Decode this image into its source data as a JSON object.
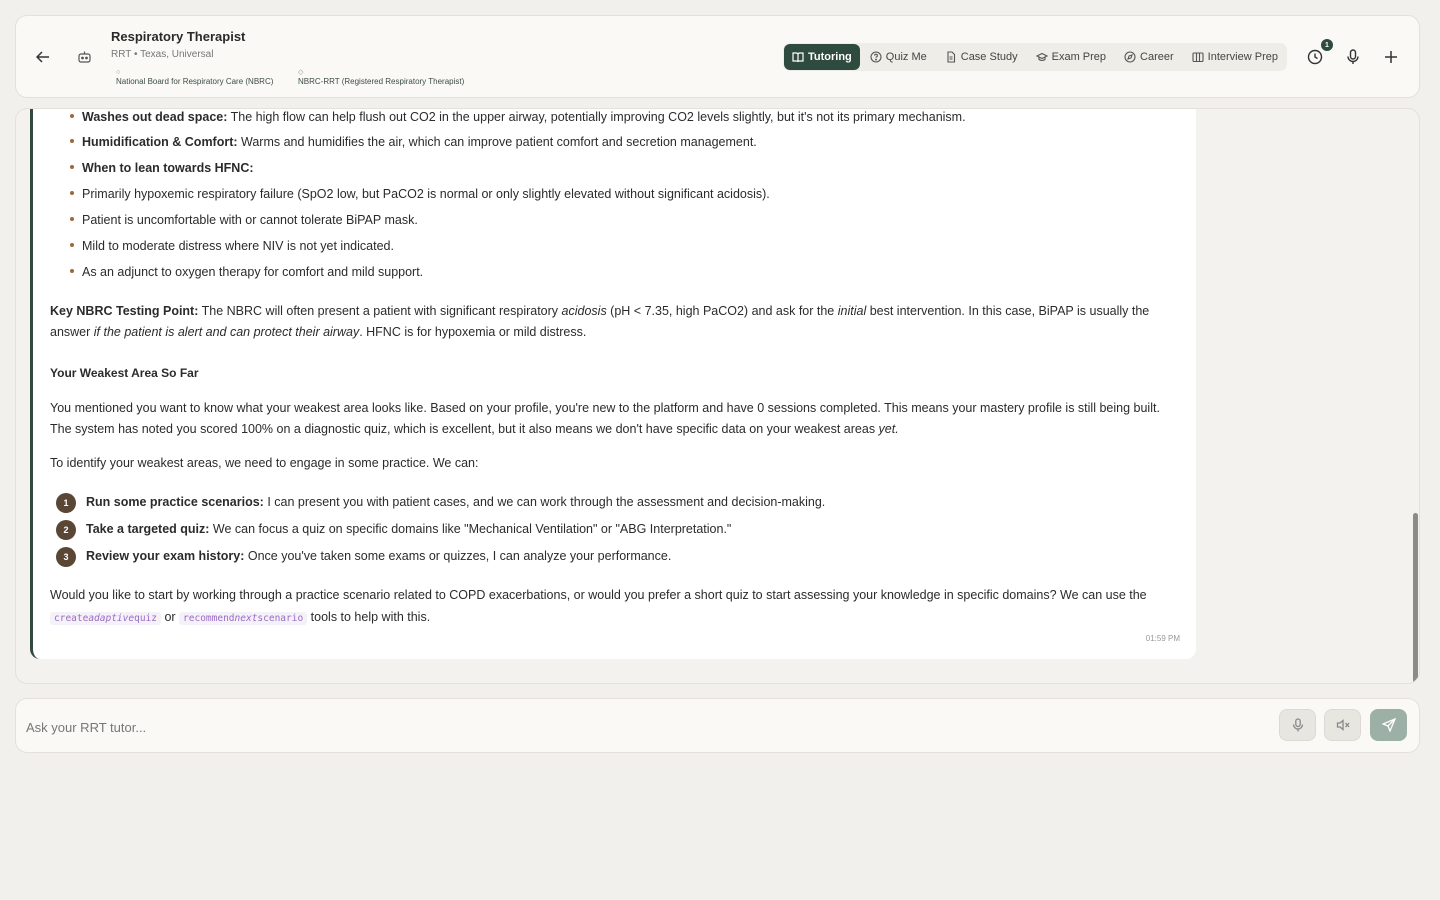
{
  "header": {
    "title": "Respiratory Therapist",
    "subtitle": "RRT • Texas, Universal",
    "badges": [
      {
        "mark": "○",
        "label": "National Board for Respiratory Care (NBRC)"
      },
      {
        "mark": "◇",
        "label": "NBRC-RRT (Registered Respiratory Therapist)"
      }
    ],
    "tabs": [
      "Tutoring",
      "Quiz Me",
      "Case Study",
      "Exam Prep",
      "Career",
      "Interview Prep"
    ],
    "active_tab": "Tutoring",
    "history_count": "1"
  },
  "message": {
    "bullets": [
      {
        "bold": "Washes out dead space:",
        "text": " The high flow can help flush out CO2 in the upper airway, potentially improving CO2 levels slightly, but it's not its primary mechanism."
      },
      {
        "bold": "Humidification & Comfort:",
        "text": " Warms and humidifies the air, which can improve patient comfort and secretion management."
      },
      {
        "bold": "When to lean towards HFNC:",
        "text": ""
      },
      {
        "bold": "",
        "text": "Primarily hypoxemic respiratory failure (SpO2 low, but PaCO2 is normal or only slightly elevated without significant acidosis)."
      },
      {
        "bold": "",
        "text": "Patient is uncomfortable with or cannot tolerate BiPAP mask."
      },
      {
        "bold": "",
        "text": "Mild to moderate distress where NIV is not yet indicated."
      },
      {
        "bold": "",
        "text": "As an adjunct to oxygen therapy for comfort and mild support."
      }
    ],
    "key_point": {
      "bold": "Key NBRC Testing Point:",
      "t1": " The NBRC will often present a patient with significant respiratory ",
      "i1": "acidosis",
      "t2": " (pH < 7.35, high PaCO2) and ask for the ",
      "i2": "initial",
      "t3": " best intervention. In this case, BiPAP is usually the answer ",
      "i3": "if the patient is alert and can protect their airway",
      "t4": ". HFNC is for hypoxemia or mild distress."
    },
    "heading": "Your Weakest Area So Far",
    "weak_para": {
      "text": "You mentioned you want to know what your weakest area looks like. Based on your profile, you're new to the platform and have 0 sessions completed. This means your mastery profile is still being built. The system has noted you scored 100% on a diagnostic quiz, which is excellent, but it also means we don't have specific data on your weakest areas ",
      "italic": "yet."
    },
    "identify": "To identify your weakest areas, we need to engage in some practice. We can:",
    "options": [
      {
        "num": "1",
        "bold": "Run some practice scenarios:",
        "text": " I can present you with patient cases, and we can work through the assessment and decision-making."
      },
      {
        "num": "2",
        "bold": "Take a targeted quiz:",
        "text": " We can focus a quiz on specific domains like \"Mechanical Ventilation\" or \"ABG Interpretation.\""
      },
      {
        "num": "3",
        "bold": "Review your exam history:",
        "text": " Once you've taken some exams or quizzes, I can analyze your performance."
      }
    ],
    "closing": {
      "t1": "Would you like to start by working through a practice scenario related to COPD exacerbations, or would you prefer a short quiz to start assessing your knowledge in specific domains? We can use the ",
      "code1a": "create",
      "code1b": "adaptive",
      "code1c": "quiz",
      "t2": " or ",
      "code2a": "recommend",
      "code2b": "next",
      "code2c": "scenario",
      "t3": " tools to help with this."
    },
    "timestamp": "01:59 PM"
  },
  "composer": {
    "placeholder": "Ask your RRT tutor..."
  },
  "colors": {
    "accent": "#2f4a3f",
    "bullet": "#9a6a3a",
    "code": "#9a6cc7"
  }
}
